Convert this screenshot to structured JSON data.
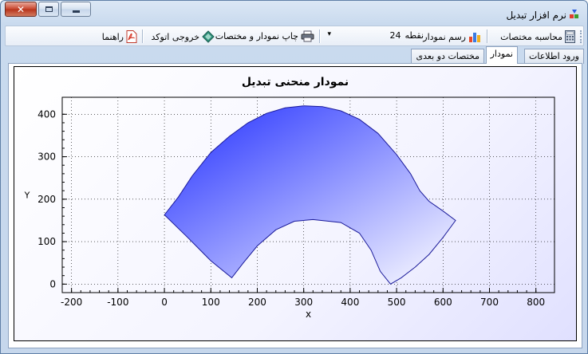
{
  "window": {
    "title": "نرم افزار تبدیل",
    "controls": {
      "close": "✕"
    }
  },
  "toolbar": {
    "calc_coords": "محاسبه مختصات",
    "draw_chart": "رسم نمودار",
    "points_value": "24",
    "points_unit": "نقطه",
    "dropdown_arrow": "▾",
    "print_label": "چاپ نمودار و مختصات",
    "autocad_label": "خروجی اتوکد",
    "help_label": "راهنما"
  },
  "tabs": [
    {
      "label": "ورود اطلاعات",
      "active": false
    },
    {
      "label": "نمودار",
      "active": true
    },
    {
      "label": "مختصات دو بعدی",
      "active": false
    }
  ],
  "chart_data": {
    "type": "area",
    "title": "نمودار منحنی تبدیل",
    "xlabel": "x",
    "ylabel": "Y",
    "xlim": [
      -220,
      840
    ],
    "ylim": [
      -20,
      440
    ],
    "x_ticks": [
      -200,
      -100,
      0,
      100,
      200,
      300,
      400,
      500,
      600,
      700,
      800
    ],
    "y_ticks": [
      0,
      100,
      200,
      300,
      400
    ],
    "grid": true,
    "fill_colors": [
      "#1f2cff",
      "#ffffff"
    ],
    "outline_color": "#1a1a9a",
    "upper_boundary": [
      {
        "x": 0,
        "y": 163
      },
      {
        "x": 30,
        "y": 205
      },
      {
        "x": 60,
        "y": 255
      },
      {
        "x": 100,
        "y": 310
      },
      {
        "x": 140,
        "y": 348
      },
      {
        "x": 180,
        "y": 380
      },
      {
        "x": 220,
        "y": 402
      },
      {
        "x": 260,
        "y": 415
      },
      {
        "x": 300,
        "y": 420
      },
      {
        "x": 340,
        "y": 418
      },
      {
        "x": 380,
        "y": 408
      },
      {
        "x": 420,
        "y": 388
      },
      {
        "x": 460,
        "y": 355
      },
      {
        "x": 500,
        "y": 305
      },
      {
        "x": 530,
        "y": 260
      },
      {
        "x": 550,
        "y": 220
      },
      {
        "x": 570,
        "y": 195
      },
      {
        "x": 600,
        "y": 172
      },
      {
        "x": 627,
        "y": 150
      }
    ],
    "lower_boundary": [
      {
        "x": 627,
        "y": 150
      },
      {
        "x": 600,
        "y": 110
      },
      {
        "x": 570,
        "y": 70
      },
      {
        "x": 540,
        "y": 40
      },
      {
        "x": 510,
        "y": 15
      },
      {
        "x": 487,
        "y": 0
      },
      {
        "x": 465,
        "y": 30
      },
      {
        "x": 445,
        "y": 80
      },
      {
        "x": 420,
        "y": 120
      },
      {
        "x": 380,
        "y": 145
      },
      {
        "x": 320,
        "y": 152
      },
      {
        "x": 280,
        "y": 148
      },
      {
        "x": 240,
        "y": 128
      },
      {
        "x": 200,
        "y": 90
      },
      {
        "x": 170,
        "y": 50
      },
      {
        "x": 145,
        "y": 15
      },
      {
        "x": 100,
        "y": 55
      },
      {
        "x": 50,
        "y": 110
      },
      {
        "x": 0,
        "y": 163
      }
    ]
  }
}
